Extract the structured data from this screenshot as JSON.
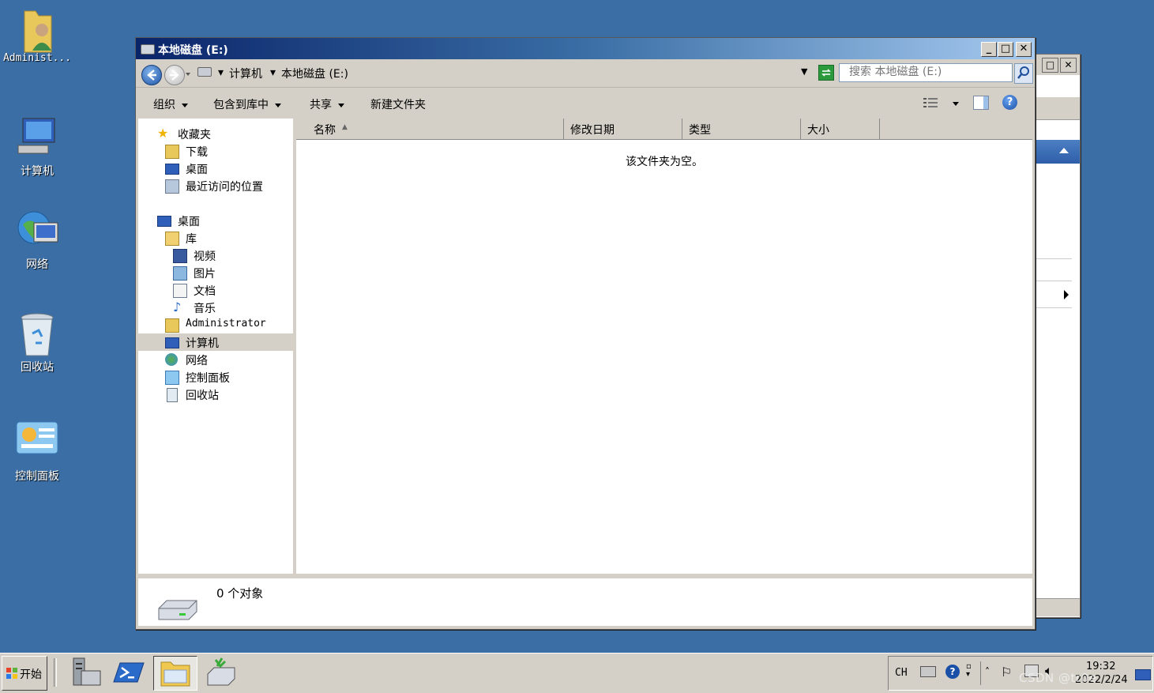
{
  "desktop": {
    "icons": [
      {
        "label": "Administ..."
      },
      {
        "label": "计算机"
      },
      {
        "label": "网络"
      },
      {
        "label": "回收站"
      },
      {
        "label": "控制面板"
      }
    ]
  },
  "window": {
    "title": "本地磁盘 (E:)",
    "minimize_glyph": "_",
    "maximize_glyph": "□",
    "close_glyph": "✕"
  },
  "address": {
    "crumbs": [
      "计算机",
      "本地磁盘 (E:)"
    ],
    "search_placeholder": "搜索 本地磁盘 (E:)"
  },
  "commands": {
    "organize": "组织",
    "include_in_library": "包含到库中",
    "share": "共享",
    "new_folder": "新建文件夹"
  },
  "nav": {
    "items": [
      {
        "label": "收藏夹",
        "icon": "star-icon"
      },
      {
        "label": "下载",
        "icon": "download-folder-icon"
      },
      {
        "label": "桌面",
        "icon": "desktop-icon"
      },
      {
        "label": "最近访问的位置",
        "icon": "recent-places-icon"
      },
      {
        "label": "桌面",
        "icon": "desktop-icon"
      },
      {
        "label": "库",
        "icon": "library-icon"
      },
      {
        "label": "视频",
        "icon": "video-icon"
      },
      {
        "label": "图片",
        "icon": "pictures-icon"
      },
      {
        "label": "文档",
        "icon": "documents-icon"
      },
      {
        "label": "音乐",
        "icon": "music-icon"
      },
      {
        "label": "Administrator",
        "icon": "user-folder-icon"
      },
      {
        "label": "计算机",
        "icon": "computer-icon"
      },
      {
        "label": "网络",
        "icon": "network-icon"
      },
      {
        "label": "控制面板",
        "icon": "control-panel-icon"
      },
      {
        "label": "回收站",
        "icon": "recycle-bin-icon"
      }
    ]
  },
  "columns": {
    "name": "名称",
    "modified": "修改日期",
    "type": "类型",
    "size": "大小"
  },
  "content": {
    "empty_message": "该文件夹为空。"
  },
  "details": {
    "count_text": "0 个对象"
  },
  "taskbar": {
    "start_label": "开始",
    "language": "CH",
    "time": "19:32",
    "date": "2022/2/24"
  },
  "watermark": "CSDN @tr0e",
  "colors": {
    "desktop": "#3a6ea5",
    "titlebar_start": "#0a246a",
    "titlebar_end": "#a6caf0",
    "chrome": "#d4d0c8"
  }
}
